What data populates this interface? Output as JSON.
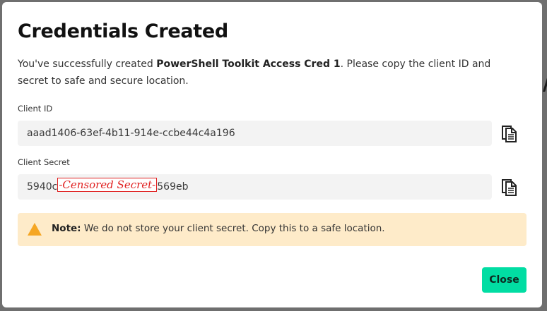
{
  "dialog": {
    "title": "Credentials Created",
    "intro_prefix": "You've successfully created ",
    "cred_name": "PowerShell Toolkit Access Cred 1",
    "intro_suffix": ". Please copy the client ID and secret to safe and secure location."
  },
  "client_id": {
    "label": "Client ID",
    "value": "aaad1406-63ef-4b11-914e-ccbe44c4a196",
    "copy_icon": "copy-icon"
  },
  "client_secret": {
    "label": "Client Secret",
    "value_start": "5940c",
    "censor_text": "-Censored Secret-",
    "value_end": "569eb",
    "copy_icon": "copy-icon"
  },
  "note": {
    "icon": "warning-icon",
    "bold": "Note:",
    "text": " We do not store your client secret. Copy this to a safe location."
  },
  "actions": {
    "close_label": "Close"
  },
  "colors": {
    "accent": "#01dda3",
    "note_bg": "#feebc9",
    "warning": "#f5a623",
    "censor": "#e02020"
  }
}
